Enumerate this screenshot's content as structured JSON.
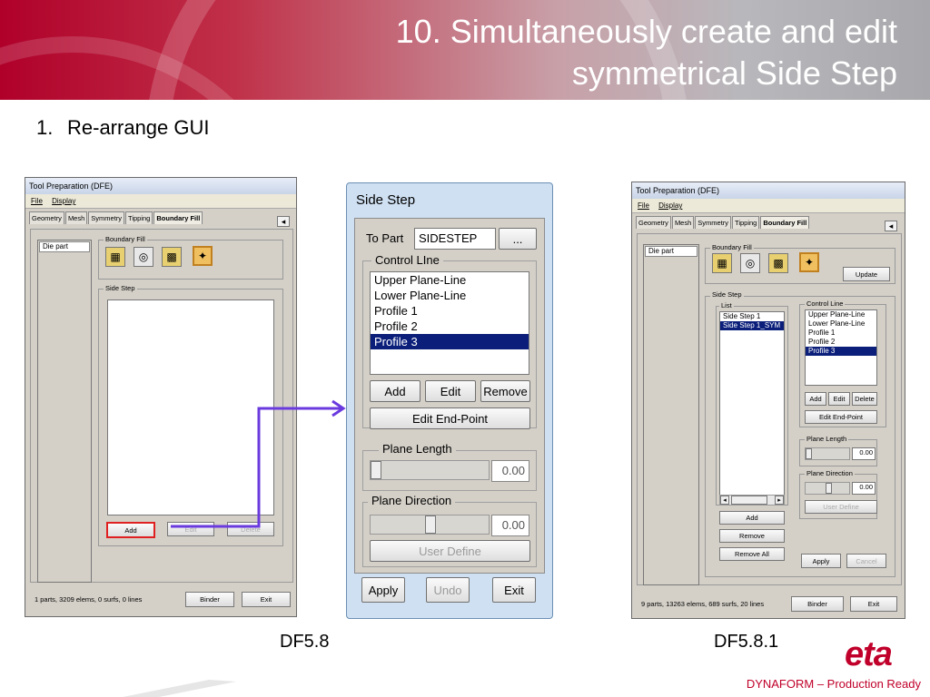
{
  "title": "10. Simultaneously create and edit symmetrical Side Step",
  "title_line1": "10. Simultaneously create and edit",
  "title_line2": "symmetrical Side Step",
  "subhead": {
    "num": "1.",
    "text": "Re-arrange GUI"
  },
  "left_window": {
    "title": "Tool Preparation (DFE)",
    "menu": [
      "File",
      "Display"
    ],
    "tabs": [
      "Geometry",
      "Mesh",
      "Symmetry",
      "Tipping",
      "Boundary Fill"
    ],
    "active_tab": "Boundary Fill",
    "part_list": [
      "Die part"
    ],
    "boundary_fill_label": "Boundary Fill",
    "side_step_label": "Side Step",
    "buttons": {
      "add": "Add",
      "edit": "Edit",
      "delete": "Delete",
      "binder": "Binder",
      "exit": "Exit"
    },
    "status": "1 parts, 3209 elems, 0 surfs, 0 lines"
  },
  "middle_window": {
    "title": "Side Step",
    "to_part_label": "To Part",
    "to_part_value": "SIDESTEP",
    "browse": "...",
    "control_line_label": "Control LIne",
    "control_lines": [
      "Upper Plane-Line",
      "Lower Plane-Line",
      "Profile 1",
      "Profile 2",
      "Profile 3"
    ],
    "selected_index": 4,
    "buttons": {
      "add": "Add",
      "edit": "Edit",
      "remove": "Remove",
      "edit_end": "Edit End-Point",
      "user_define": "User Define",
      "apply": "Apply",
      "undo": "Undo",
      "exit": "Exit"
    },
    "plane_length_label": "Plane Length",
    "plane_length_value": "0.00",
    "plane_length_level": 0,
    "plane_direction_label": "Plane Direction",
    "plane_direction_value": "0.00",
    "plane_direction_level": 0.5
  },
  "right_window": {
    "title": "Tool Preparation (DFE)",
    "menu": [
      "File",
      "Display"
    ],
    "tabs": [
      "Geometry",
      "Mesh",
      "Symmetry",
      "Tipping",
      "Boundary Fill"
    ],
    "active_tab": "Boundary Fill",
    "part_list": [
      "Die part"
    ],
    "boundary_fill_label": "Boundary Fill",
    "update": "Update",
    "side_step_label": "Side Step",
    "list_label": "List",
    "list_items": [
      "Side Step 1",
      "Side Step 1_SYM"
    ],
    "control_line_label": "Control Line",
    "control_lines": [
      "Upper Plane-Line",
      "Lower Plane-Line",
      "Profile 1",
      "Profile 2",
      "Profile 3"
    ],
    "selected_index": 4,
    "buttons": {
      "add": "Add",
      "edit": "Edit",
      "delete": "Delete",
      "edit_end": "Edit End-Point",
      "user_define": "User Define",
      "list_add": "Add",
      "remove": "Remove",
      "remove_all": "Remove All",
      "apply": "Apply",
      "cancel": "Cancel",
      "binder": "Binder",
      "exit": "Exit"
    },
    "plane_length_label": "Plane Length",
    "plane_length_value": "0.00",
    "plane_direction_label": "Plane Direction",
    "plane_direction_value": "0.00",
    "status": "9 parts, 13263 elems, 689 surfs, 20 lines"
  },
  "labels": {
    "left": "DF5.8",
    "right": "DF5.8.1"
  },
  "footer": "DYNAFORM – Production Ready",
  "logo": "eta",
  "colors": {
    "brand": "#c0002a",
    "selection": "#0a1e7a",
    "arrow": "#6a3adf",
    "highlight": "#e02020"
  }
}
